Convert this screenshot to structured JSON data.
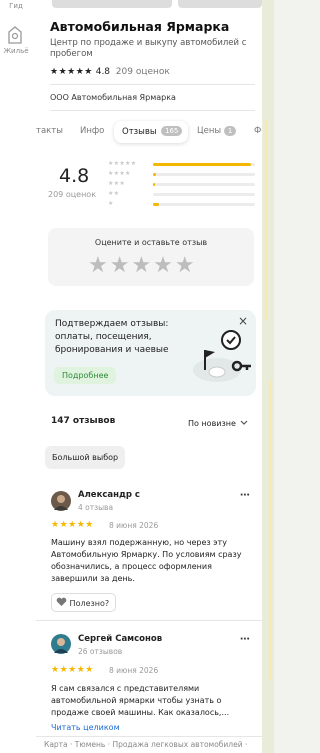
{
  "left_rail": {
    "item1_label": "Гид",
    "item2_label": "Жильё"
  },
  "header": {
    "title": "Автомобильная Ярмарка",
    "subtitle": "Центр по продаже и выкупу автомобилей с пробегом",
    "rating": "4.8",
    "rating_count": "209 оценок",
    "organization": "ООО Автомобильная Ярмарка"
  },
  "tabs": [
    {
      "label": "Контакты",
      "visible_text": "такты"
    },
    {
      "label": "Инфо"
    },
    {
      "label": "Отзывы",
      "badge": "165"
    },
    {
      "label": "Цены",
      "badge": "1"
    },
    {
      "label": "Фото",
      "visible_text": "Фо"
    }
  ],
  "summary": {
    "rating": "4.8",
    "count": "209 оценок",
    "distribution": [
      0.96,
      0.03,
      0.02,
      0.0,
      0.06
    ]
  },
  "rate_box": {
    "title": "Оцените и оставьте отзыв",
    "stars": "★★★★★"
  },
  "promo": {
    "text": "Подтверждаем отзывы: оплаты, посещения, бронирования и чаевые",
    "button": "Подробнее",
    "close": "×"
  },
  "reviews_header": {
    "count": "147 отзывов",
    "sort": "По новизне",
    "chip": "Большой выбор"
  },
  "reviews": [
    {
      "author": "Александр с",
      "meta": "4 отзыва",
      "rating_stars": "★★★★★",
      "date": "8 июня 2026",
      "text": "Машину взял подержанную, но через эту Автомобильную Ярмарку. По условиям сразу обозначились, а процесс оформления завершили за день.",
      "useful_label": "Полезно?"
    },
    {
      "author": "Сергей Самсонов",
      "meta": "26 отзывов",
      "rating_stars": "★★★★★",
      "date": "8 июня 2026",
      "text": "Я сам связался с представителями автомобильной ярмарки чтобы узнать о продаже своей машины. Как оказалось,...",
      "read_more": "Читать целиком"
    }
  ],
  "footer": {
    "breadcrumb": "Карта · Тюмень · Продажа легковых автомобилей ·"
  },
  "colors": {
    "accent_star": "#f5b800",
    "link": "#1a6ad6",
    "promo_button": "#2d8a37"
  }
}
